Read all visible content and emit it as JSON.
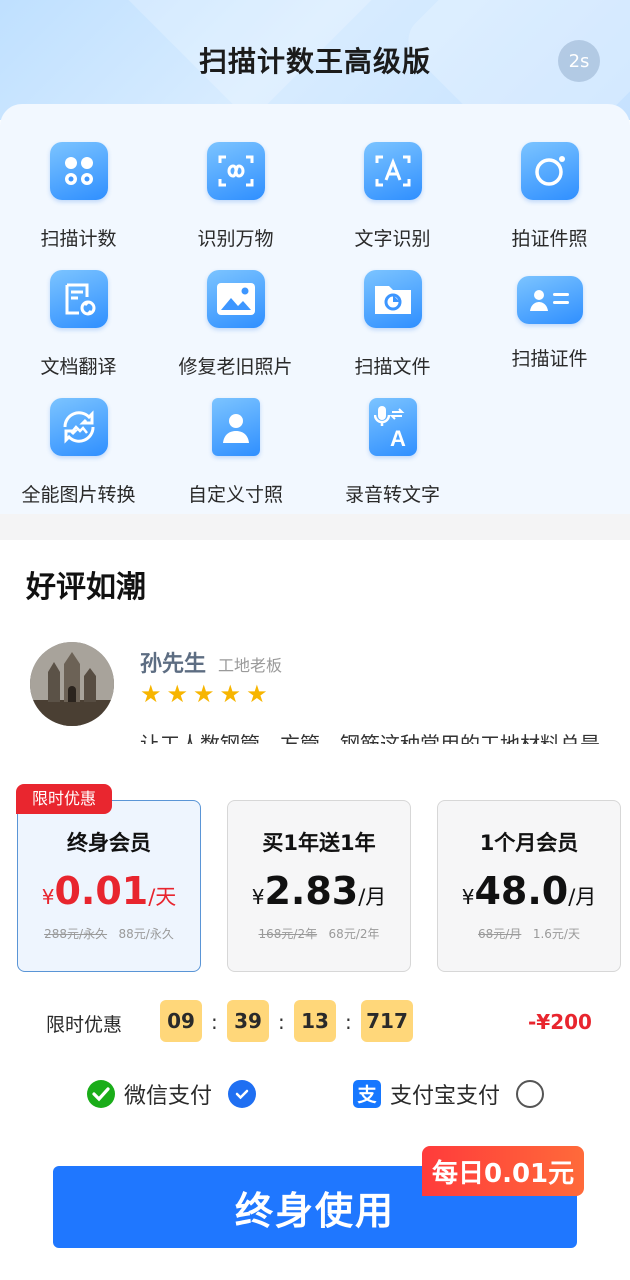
{
  "header": {
    "title": "扫描计数王高级版",
    "timer": "2s"
  },
  "features": [
    {
      "label": "扫描计数",
      "icon": "grid-icon"
    },
    {
      "label": "识别万物",
      "icon": "scan-infinity-icon"
    },
    {
      "label": "文字识别",
      "icon": "text-recognition-icon"
    },
    {
      "label": "拍证件照",
      "icon": "camera-icon"
    },
    {
      "label": "文档翻译",
      "icon": "document-translate-icon"
    },
    {
      "label": "修复老旧照片",
      "icon": "image-icon"
    },
    {
      "label": "扫描文件",
      "icon": "scan-file-icon"
    },
    {
      "label": "扫描证件",
      "icon": "id-card-icon"
    },
    {
      "label": "全能图片转换",
      "icon": "image-convert-icon"
    },
    {
      "label": "自定义寸照",
      "icon": "portrait-icon"
    },
    {
      "label": "录音转文字",
      "icon": "voice-to-text-icon"
    }
  ],
  "reviews": {
    "title": "好评如潮",
    "items": [
      {
        "name": "孙先生",
        "role": "工地老板",
        "stars": 5,
        "text": "让工人数钢管、方管、钢筋这种常用的工地材料总是"
      }
    ]
  },
  "plans": [
    {
      "tag": "限时优惠",
      "name": "终身会员",
      "currency": "¥",
      "price": "0.01",
      "unit": "/天",
      "sub_original": "288元/永久",
      "sub_current": "88元/永久",
      "selected": true
    },
    {
      "tag": "",
      "name": "买1年送1年",
      "currency": "¥",
      "price": "2.83",
      "unit": "/月",
      "sub_original": "168元/2年",
      "sub_current": "68元/2年",
      "selected": false
    },
    {
      "tag": "",
      "name": "1个月会员",
      "currency": "¥",
      "price": "48.0",
      "unit": "/月",
      "sub_original": "68元/月",
      "sub_current": "1.6元/天",
      "selected": false
    }
  ],
  "countdown": {
    "label": "限时优惠",
    "hours": "09",
    "minutes": "39",
    "seconds": "13",
    "millis": "717",
    "discount": "-¥200"
  },
  "payment": {
    "wechat": {
      "label": "微信支付",
      "selected": true,
      "color": "#1aad19"
    },
    "alipay": {
      "label": "支付宝支付",
      "selected": false,
      "color": "#1677ff"
    }
  },
  "cta": {
    "label": "终身使用",
    "badge": "每日0.01元"
  },
  "colors": {
    "accent": "#1f77ff",
    "price_red": "#e8252e",
    "countdown_bg": "#ffd77a",
    "star": "#f7b500"
  }
}
